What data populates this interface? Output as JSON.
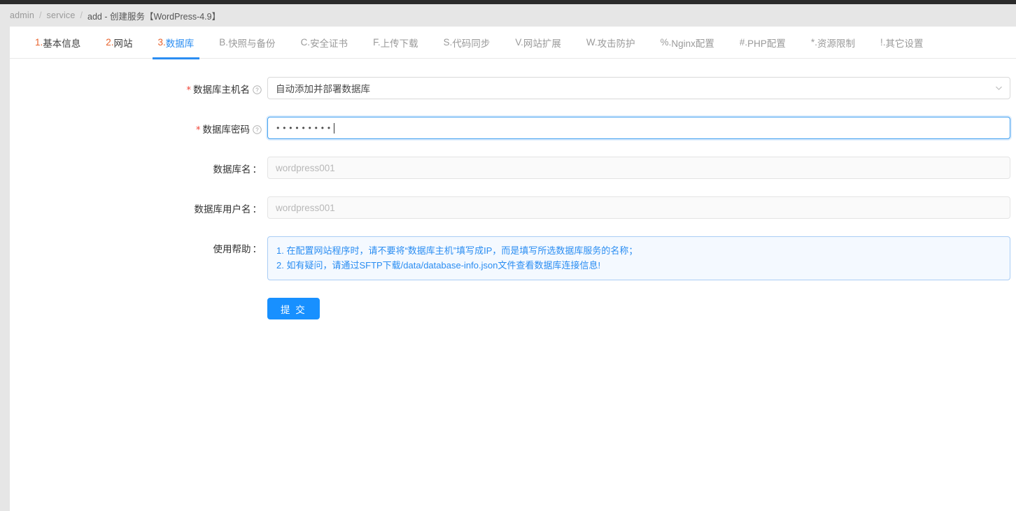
{
  "breadcrumb": {
    "items": [
      "admin",
      "service",
      "add"
    ],
    "separator": "/",
    "current": "add - 创建服务【WordPress-4.9】",
    "dash": "-",
    "title": "创建服务【WordPress-4.9】"
  },
  "tabs": [
    {
      "prefix": "1.",
      "label": "基本信息",
      "active": false,
      "accent": true
    },
    {
      "prefix": "2.",
      "label": "网站",
      "active": false,
      "accent": true
    },
    {
      "prefix": "3.",
      "label": "数据库",
      "active": true,
      "accent": true
    },
    {
      "prefix": "B.",
      "label": "快照与备份",
      "active": false,
      "accent": false
    },
    {
      "prefix": "C.",
      "label": "安全证书",
      "active": false,
      "accent": false
    },
    {
      "prefix": "F.",
      "label": "上传下载",
      "active": false,
      "accent": false
    },
    {
      "prefix": "S.",
      "label": "代码同步",
      "active": false,
      "accent": false
    },
    {
      "prefix": "V.",
      "label": "网站扩展",
      "active": false,
      "accent": false
    },
    {
      "prefix": "W.",
      "label": "攻击防护",
      "active": false,
      "accent": false
    },
    {
      "prefix": "%.",
      "label": "Nginx配置",
      "active": false,
      "accent": false
    },
    {
      "prefix": "#.",
      "label": "PHP配置",
      "active": false,
      "accent": false
    },
    {
      "prefix": "*.",
      "label": "资源限制",
      "active": false,
      "accent": false
    },
    {
      "prefix": "!.",
      "label": "其它设置",
      "active": false,
      "accent": false
    }
  ],
  "form": {
    "db_host": {
      "label": "数据库主机名",
      "required": true,
      "value": "自动添加并部署数据库"
    },
    "db_password": {
      "label": "数据库密码",
      "required": true,
      "value": "•••••••••"
    },
    "db_name": {
      "label": "数据库名",
      "colon": "：",
      "placeholder": "wordpress001"
    },
    "db_user": {
      "label": "数据库用户名",
      "colon": "：",
      "placeholder": "wordpress001"
    },
    "help": {
      "label": "使用帮助",
      "colon": "：",
      "lines": [
        "1. 在配置网站程序时，请不要将“数据库主机”填写成IP，而是填写所选数据库服务的名称；",
        "2. 如有疑问，请通过SFTP下载/data/database-info.json文件查看数据库连接信息!"
      ]
    },
    "submit_label": "提 交"
  },
  "colors": {
    "accent_blue": "#2a8df2",
    "button_blue": "#1890ff",
    "accent_orange": "#e8622c",
    "required_red": "#f04134",
    "help_bg": "#f4f9ff",
    "help_border": "#a9cdf5"
  }
}
